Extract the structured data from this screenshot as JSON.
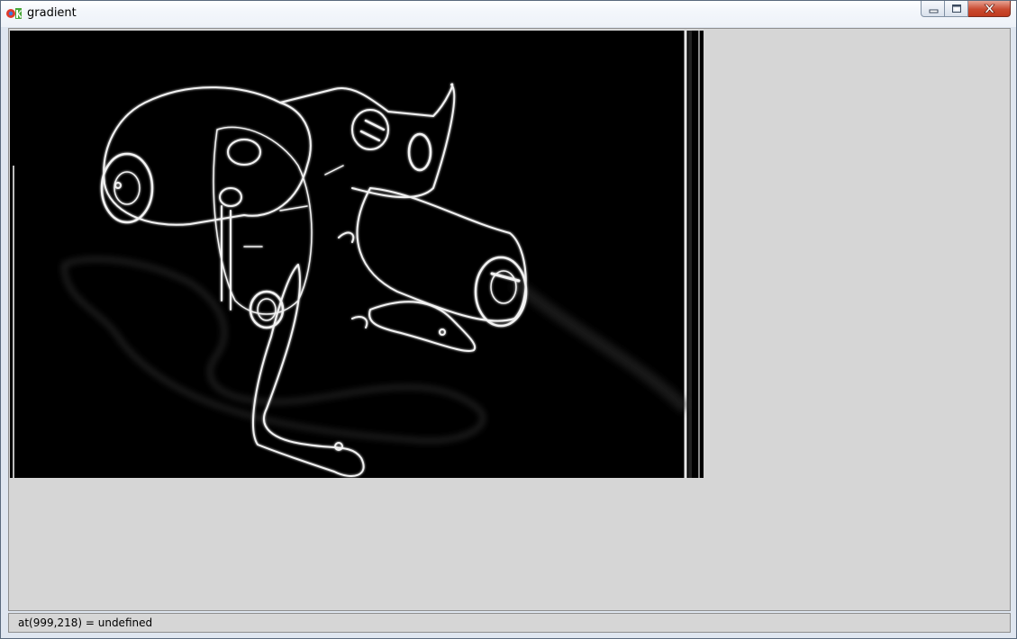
{
  "window": {
    "title": "gradient",
    "controls": {
      "minimize_icon": "minimize-icon",
      "maximize_icon": "maximize-icon",
      "close_icon": "close-icon"
    }
  },
  "image_view": {
    "content": "edge-gradient-render"
  },
  "status": {
    "text": "at(999,218) = undefined"
  },
  "colors": {
    "client_bg": "#d6d6d6",
    "image_bg": "#000000",
    "close_button": "#c94a30"
  }
}
